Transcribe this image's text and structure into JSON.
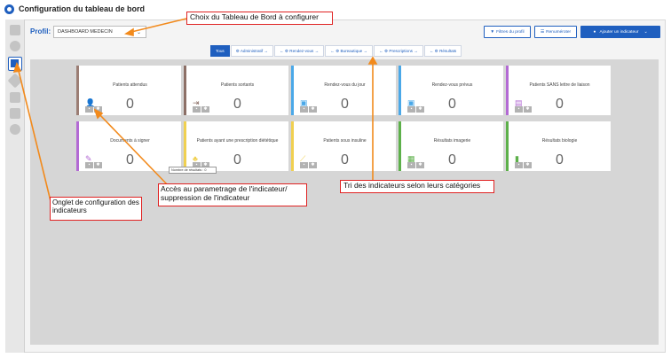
{
  "titlebar": {
    "title": "Configuration du tableau de bord"
  },
  "profile": {
    "label": "Profil:",
    "value": "DASHBOARD MEDECIN"
  },
  "toolbar": {
    "filter_label": "Filtres du profil",
    "renumber_label": "Renuméroter",
    "add_label": "Ajouter un indicateur"
  },
  "tabs": [
    {
      "label": "Tous",
      "active": true
    },
    {
      "label": "⚙ Administratif →"
    },
    {
      "label": "← ⚙ Rendez-vous →"
    },
    {
      "label": "← ⚙ Bureautique →"
    },
    {
      "label": "← ⚙ Prescriptions →"
    },
    {
      "label": "← ⚙ Résultats"
    }
  ],
  "cards": [
    {
      "title": "Patients attendus",
      "value": "0",
      "color": "#9b7d74",
      "icon": "person-icon"
    },
    {
      "title": "Patients sortants",
      "value": "0",
      "color": "#8c6f66",
      "icon": "exit-icon"
    },
    {
      "title": "Rendez-vous du jour",
      "value": "0",
      "color": "#4aa8e8",
      "icon": "calendar-icon"
    },
    {
      "title": "Rendez-vous prévus",
      "value": "0",
      "color": "#4aa8e8",
      "icon": "calendar-icon"
    },
    {
      "title": "Patients SANS lettre de liaison",
      "value": "0",
      "color": "#b36ad4",
      "icon": "document-icon"
    },
    {
      "title": "Documents à signer",
      "value": "0",
      "color": "#b36ad4",
      "icon": "signature-icon"
    },
    {
      "title": "Patients ayant une prescription diététique",
      "value": "0",
      "color": "#f0d050",
      "icon": "apple-icon"
    },
    {
      "title": "Patients sous insuline",
      "value": "0",
      "color": "#f0d050",
      "icon": "syringe-icon"
    },
    {
      "title": "Résultats imagerie",
      "value": "0",
      "color": "#5db04a",
      "icon": "xray-icon"
    },
    {
      "title": "Résultats biologie",
      "value": "0",
      "color": "#5db04a",
      "icon": "tube-icon"
    }
  ],
  "tooltip": "Nombre de résultats : 0",
  "callouts": {
    "profile_choice": "Choix du Tableau de Bord à configurer",
    "config_tab": "Onglet de configuration des indicateurs",
    "settings": "Accès au parametrage de l'indicateur/ suppression de l'indicateur",
    "sort": "Tri des indicateurs selon leurs catégories"
  },
  "colors": {
    "accent": "#1f5fbf",
    "annotation": "#e02222",
    "arrow": "#f28a1c"
  }
}
